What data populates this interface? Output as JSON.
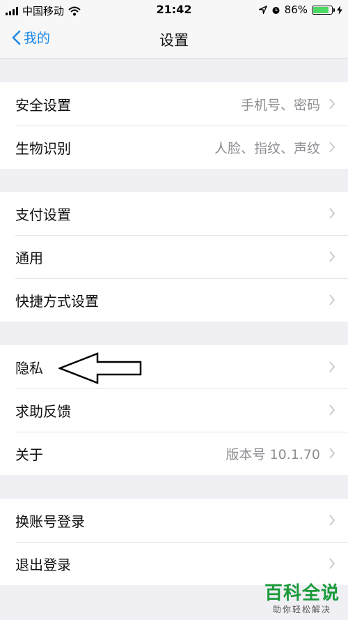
{
  "status_bar": {
    "carrier": "中国移动",
    "time": "21:42",
    "battery": "86%",
    "battery_level": 0.86
  },
  "nav": {
    "back_label": "我的",
    "title": "设置"
  },
  "groups": [
    {
      "items": [
        {
          "label": "安全设置",
          "value": "手机号、密码"
        },
        {
          "label": "生物识别",
          "value": "人脸、指纹、声纹"
        }
      ]
    },
    {
      "items": [
        {
          "label": "支付设置",
          "value": ""
        },
        {
          "label": "通用",
          "value": ""
        },
        {
          "label": "快捷方式设置",
          "value": ""
        }
      ]
    },
    {
      "items": [
        {
          "label": "隐私",
          "value": ""
        },
        {
          "label": "求助反馈",
          "value": ""
        },
        {
          "label": "关于",
          "value": "版本号 10.1.70"
        }
      ]
    },
    {
      "items": [
        {
          "label": "换账号登录",
          "value": ""
        },
        {
          "label": "退出登录",
          "value": ""
        }
      ]
    }
  ],
  "watermark": {
    "title": "百科全说",
    "subtitle": "助你轻松解决"
  }
}
